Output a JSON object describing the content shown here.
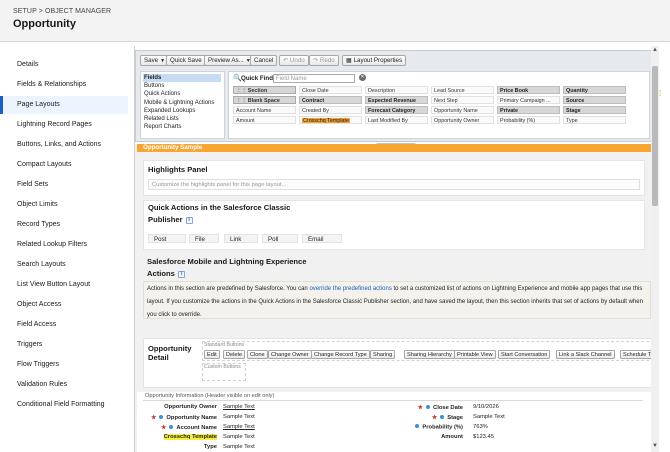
{
  "header": {
    "breadcrumb": "SETUP > OBJECT MANAGER",
    "title": "Opportunity"
  },
  "sidebar": {
    "items": [
      {
        "label": "Details"
      },
      {
        "label": "Fields & Relationships"
      },
      {
        "label": "Page Layouts",
        "active": true
      },
      {
        "label": "Lightning Record Pages"
      },
      {
        "label": "Buttons, Links, and Actions"
      },
      {
        "label": "Compact Layouts"
      },
      {
        "label": "Field Sets"
      },
      {
        "label": "Object Limits"
      },
      {
        "label": "Record Types"
      },
      {
        "label": "Related Lookup Filters"
      },
      {
        "label": "Search Layouts"
      },
      {
        "label": "List View Button Layout"
      },
      {
        "label": "Object Access"
      },
      {
        "label": "Field Access"
      },
      {
        "label": "Triggers"
      },
      {
        "label": "Flow Triggers"
      },
      {
        "label": "Validation Rules"
      },
      {
        "label": "Conditional Field Formatting"
      }
    ]
  },
  "toolbar": {
    "save": "Save",
    "quick_save": "Quick Save",
    "preview_as": "Preview As...",
    "cancel": "Cancel",
    "undo": "Undo",
    "redo": "Redo",
    "layout_properties": "Layout Properties"
  },
  "palette": {
    "categories": [
      {
        "label": "Fields",
        "selected": true
      },
      {
        "label": "Buttons"
      },
      {
        "label": "Quick Actions"
      },
      {
        "label": "Mobile & Lightning Actions"
      },
      {
        "label": "Expanded Lookups"
      },
      {
        "label": "Related Lists"
      },
      {
        "label": "Report Charts"
      }
    ],
    "quick_find_label": "Quick Find",
    "quick_find_placeholder": "Field Name",
    "fields": [
      [
        "Section",
        "Close Date",
        "Description",
        "Lead Source",
        "Price Book",
        "Quantity"
      ],
      [
        "Blank Space",
        "Contract",
        "Expected Revenue",
        "Next Step",
        "Primary Campaign ...",
        "Source"
      ],
      [
        "Account Name",
        "Created By",
        "Forecast Category",
        "Opportunity Name",
        "Private",
        "Stage"
      ],
      [
        "Amount",
        "Crosschq Template",
        "Last Modified By",
        "Opportunity Owner",
        "Probability (%)",
        "Type"
      ]
    ]
  },
  "layout": {
    "section_title": "Opportunity Sample",
    "highlights": {
      "title": "Highlights Panel",
      "placeholder": "Customize the highlights panel for this page layout..."
    },
    "classic_actions": {
      "title_line1": "Quick Actions in the Salesforce Classic",
      "title_line2": "Publisher",
      "items": [
        "Post",
        "File",
        "Link",
        "Poll",
        "Email"
      ]
    },
    "mobile_actions": {
      "title_line1": "Salesforce Mobile and Lightning Experience",
      "title_line2": "Actions",
      "note_before": "Actions in this section are predefined by Salesforce. You can ",
      "note_link": "override the predefined actions",
      "note_after": " to set a customized list of actions on Lightning Experience and mobile app pages that use this layout. If you customize the actions in the Quick Actions in the Salesforce Classic Publisher section, and have saved the layout, then this section inherits that set of actions by default when you click to override."
    },
    "detail": {
      "title_line1": "Opportunity",
      "title_line2": "Detail",
      "standard_label": "Standard Buttons",
      "custom_label": "Custom Buttons",
      "buttons": [
        "Edit",
        "Delete",
        "Clone",
        "Change Owner",
        "Change Record Type",
        "Sharing",
        "Sharing Hierarchy",
        "Printable View",
        "Start Conversation",
        "Link a Slack Channel",
        "Schedule Te"
      ]
    },
    "info_section": {
      "header": "Opportunity Information (Header visible on edit only)",
      "left": [
        {
          "label": "Opportunity Owner",
          "value": "Sample Text",
          "required": false,
          "dot": false,
          "underline": true
        },
        {
          "label": "Opportunity Name",
          "value": "Sample Text",
          "required": true,
          "dot": true,
          "underline": false
        },
        {
          "label": "Account Name",
          "value": "Sample Text",
          "required": true,
          "dot": true,
          "underline": true
        },
        {
          "label": "Crosschq Template",
          "value": "Sample Text",
          "required": false,
          "dot": false,
          "underline": false,
          "highlight": true
        },
        {
          "label": "Type",
          "value": "Sample Text",
          "required": false,
          "dot": false,
          "underline": false
        }
      ],
      "right": [
        {
          "label": "Close Date",
          "value": "9/10/2026",
          "required": true,
          "dot": true
        },
        {
          "label": "Stage",
          "value": "Sample Text",
          "required": true,
          "dot": true
        },
        {
          "label": "Probability (%)",
          "value": "763%",
          "required": false,
          "dot": true
        },
        {
          "label": "Amount",
          "value": "$123.45",
          "required": false,
          "dot": false
        }
      ]
    }
  }
}
